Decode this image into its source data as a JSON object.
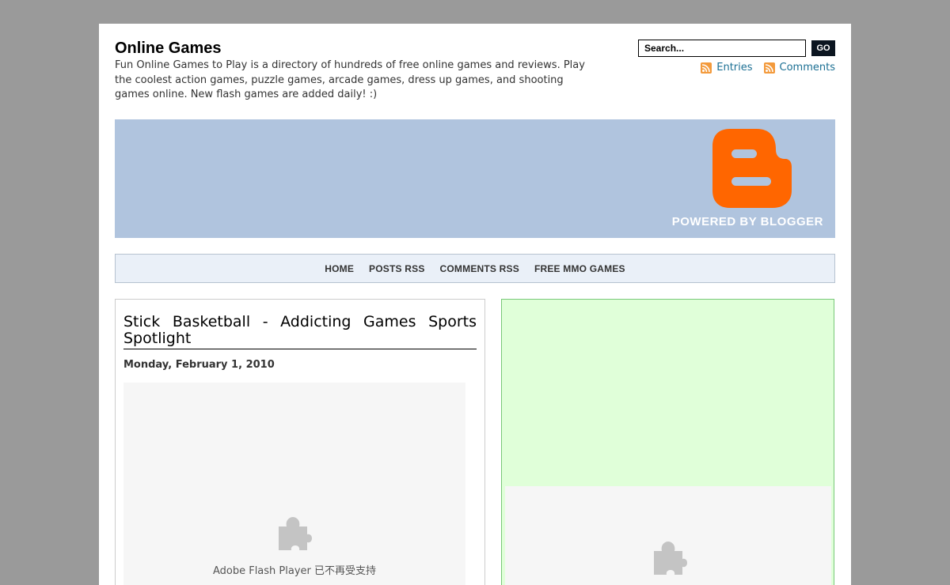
{
  "header": {
    "title": "Online Games",
    "description": "Fun Online Games to Play is a directory of hundreds of free online games and reviews. Play the coolest action games, puzzle games, arcade games, dress up games, and shooting games online. New flash games are added daily! :)"
  },
  "search": {
    "placeholder": "Search...",
    "go_label": "GO"
  },
  "feeds": {
    "entries_label": "Entries",
    "comments_label": "Comments",
    "icon": "rss-icon",
    "color": "#1b6f93"
  },
  "banner": {
    "powered_text": "POWERED BY BLOGGER",
    "logo_icon": "blogger-logo-icon",
    "logo_color": "#ff6600",
    "background": "#b0c4de"
  },
  "nav": {
    "items": [
      {
        "label": "HOME"
      },
      {
        "label": "POSTS RSS"
      },
      {
        "label": "COMMENTS RSS"
      },
      {
        "label": "FREE MMO GAMES"
      }
    ]
  },
  "post": {
    "title": "Stick Basketball - Addicting Games Sports Spotlight",
    "date": "Monday, February 1, 2010",
    "flash_message": "Adobe Flash Player 已不再受支持",
    "plugin_icon": "puzzle-piece-icon"
  },
  "sidebar": {
    "background": "#e0ffd9",
    "plugin_icon": "puzzle-piece-icon"
  }
}
